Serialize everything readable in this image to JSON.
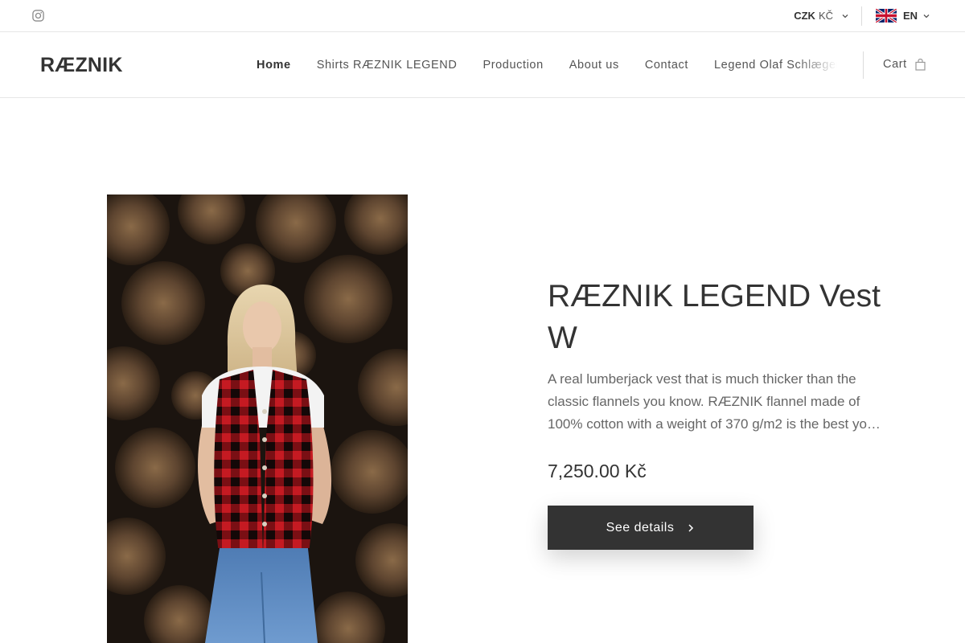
{
  "topbar": {
    "social_icon": "instagram-icon",
    "currency_code": "CZK",
    "currency_symbol": "KČ",
    "language": "EN",
    "language_flag": "uk-flag-icon"
  },
  "header": {
    "logo": "RÆZNIK",
    "nav": {
      "home": "Home",
      "shirts": "Shirts RÆZNIK LEGEND",
      "production": "Production",
      "about": "About us",
      "contact": "Contact",
      "legend": "Legend Olaf Schlægen"
    },
    "cart_label": "Cart",
    "cart_icon": "shopping-bag-icon"
  },
  "product": {
    "title": "RÆZNIK LEGEND Vest W",
    "description": "A real lumberjack vest that is much thicker than the classic flannels you know. RÆZNIK flannel made of 100% cotton with a weight of 370 g/m2 is the best yo…",
    "price": "7,250.00 Kč",
    "button_label": "See details",
    "button_icon": "chevron-right-icon"
  },
  "colors": {
    "text": "#333333",
    "muted": "#666666",
    "button_bg": "#333333",
    "border": "#e6e6e6"
  }
}
